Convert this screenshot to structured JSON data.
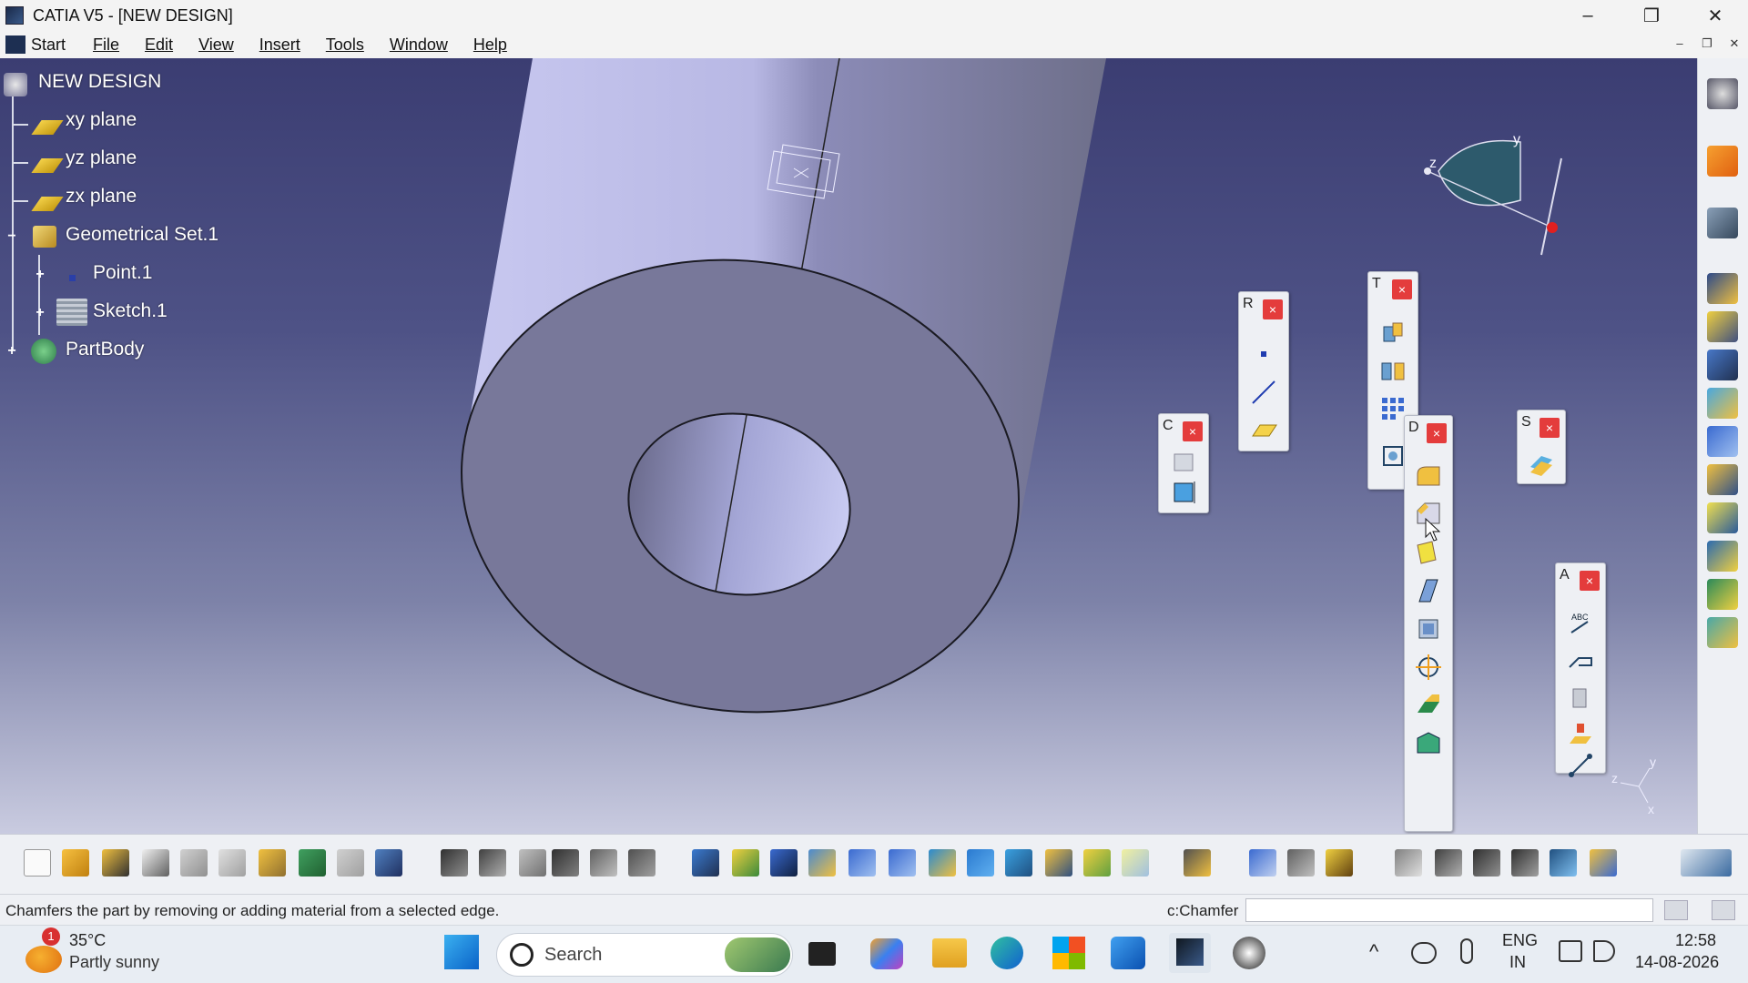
{
  "window": {
    "title": "CATIA V5 - [NEW DESIGN]",
    "minimize": "–",
    "restore": "❐",
    "close": "✕"
  },
  "menu": {
    "items": [
      "Start",
      "File",
      "Edit",
      "View",
      "Insert",
      "Tools",
      "Window",
      "Help"
    ]
  },
  "tree": {
    "root": "NEW DESIGN",
    "nodes": [
      "xy plane",
      "yz plane",
      "zx plane",
      "Geometrical Set.1",
      "Point.1",
      "Sketch.1",
      "PartBody"
    ]
  },
  "floating_toolbars": {
    "reference": {
      "letter": "R"
    },
    "transformations": {
      "letter": "T"
    },
    "dressup": {
      "letter": "D"
    },
    "constraints": {
      "letter": "C"
    },
    "surface": {
      "letter": "S"
    },
    "annotations": {
      "letter": "A"
    },
    "close_glyph": "×"
  },
  "compass": {
    "x": "x",
    "y": "y",
    "z": "z"
  },
  "status": {
    "message": "Chamfers the part by removing or adding material from a selected edge.",
    "command_label": "c:Chamfer"
  },
  "taskbar": {
    "weather_badge": "1",
    "temperature": "35°C",
    "weather": "Partly sunny",
    "search_placeholder": "Search",
    "lang_top": "ENG",
    "lang_bottom": "IN",
    "time": "12:58",
    "date": "14-08-2026"
  },
  "colors": {
    "accent_close": "#e43c3c",
    "viewport_top": "#3b3d72",
    "viewport_bottom": "#c9cbe0"
  }
}
